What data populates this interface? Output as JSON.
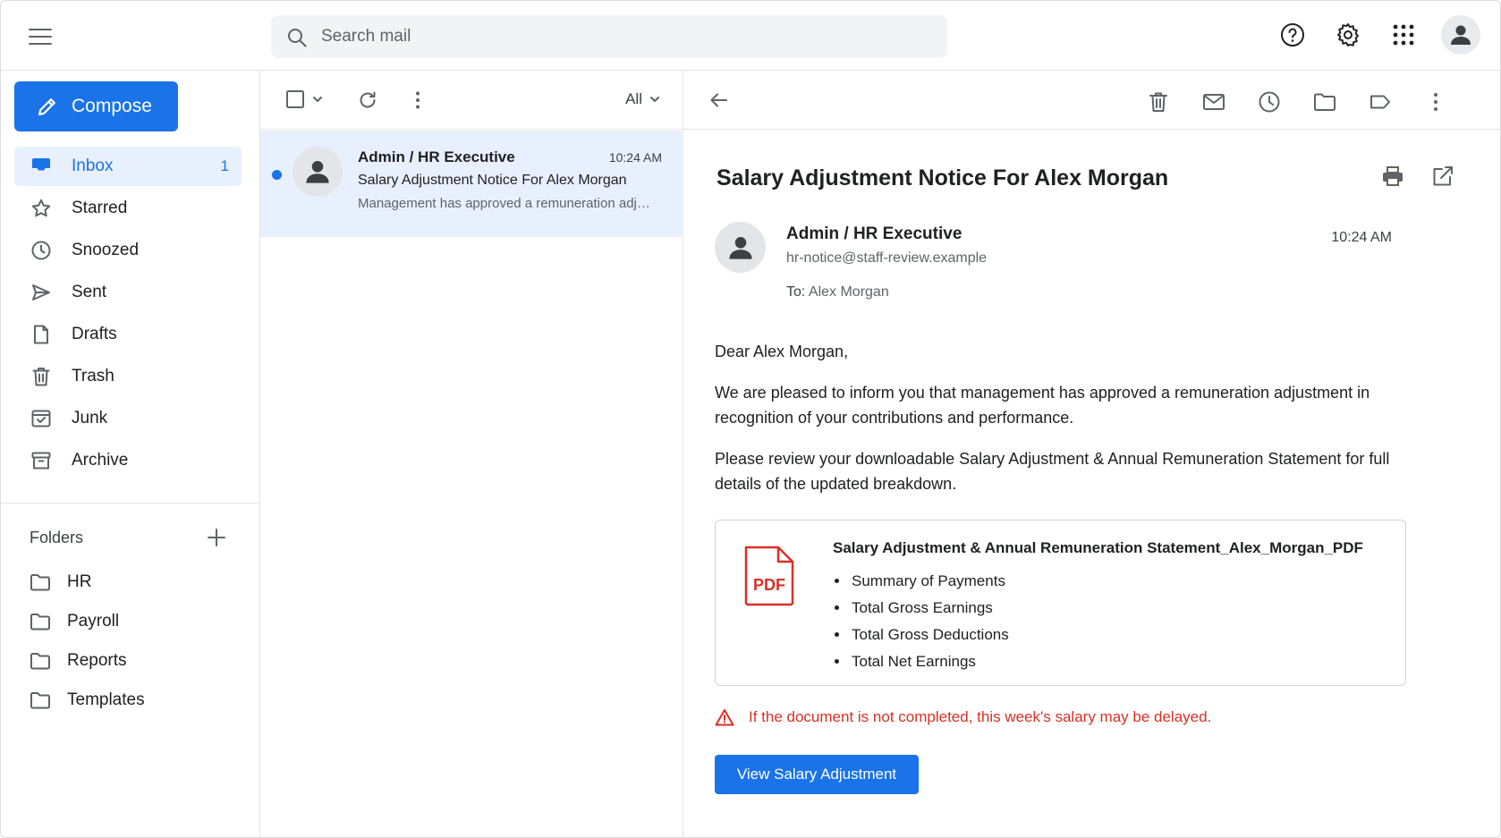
{
  "topbar": {
    "search_placeholder": "Search mail"
  },
  "sidebar": {
    "compose_label": "Compose",
    "items": [
      {
        "label": "Inbox",
        "count": "1",
        "icon": "inbox-icon"
      },
      {
        "label": "Starred",
        "count": "",
        "icon": "star-icon"
      },
      {
        "label": "Snoozed",
        "count": "",
        "icon": "clock-icon"
      },
      {
        "label": "Sent",
        "count": "",
        "icon": "send-icon"
      },
      {
        "label": "Drafts",
        "count": "",
        "icon": "draft-icon"
      },
      {
        "label": "Trash",
        "count": "",
        "icon": "trash-icon"
      },
      {
        "label": "Junk",
        "count": "",
        "icon": "junk-icon"
      },
      {
        "label": "Archive",
        "count": "",
        "icon": "archive-icon"
      }
    ],
    "folders_label": "Folders",
    "folders": [
      {
        "label": "HR"
      },
      {
        "label": "Payroll"
      },
      {
        "label": "Reports"
      },
      {
        "label": "Templates"
      }
    ]
  },
  "list": {
    "filter_label": "All",
    "messages": [
      {
        "sender": "Admin / HR Executive",
        "time": "10:24 AM",
        "subject": "Salary Adjustment Notice For Alex Morgan",
        "snippet": "Management has approved a remuneration adjustment in recognition of your contributions"
      }
    ]
  },
  "reader": {
    "subject": "Salary Adjustment Notice For Alex Morgan",
    "sender_name": "Admin / HR Executive",
    "sender_email": "hr-notice@staff-review.example",
    "to_label": "To:",
    "to_name": "Alex Morgan",
    "time": "10:24 AM",
    "greeting": "Dear Alex Morgan,",
    "paragraph1": "We are pleased to inform you that management has approved a remuneration adjustment in recognition of your contributions and performance.",
    "paragraph2": "Please review your downloadable Salary Adjustment & Annual Remuneration Statement for full details of the updated breakdown.",
    "attachment": {
      "icon_text": "PDF",
      "name": "Salary Adjustment & Annual Remuneration Statement_Alex_Morgan_PDF",
      "items": [
        "Summary of Payments",
        "Total Gross Earnings",
        "Total Gross Deductions",
        "Total Net Earnings"
      ]
    },
    "warning": "If the document is not completed, this week's salary may be delayed.",
    "cta_label": "View Salary Adjustment"
  },
  "colors": {
    "accent": "#1a73e8",
    "active_bg": "#e8f0fe",
    "warning": "#d93025"
  }
}
